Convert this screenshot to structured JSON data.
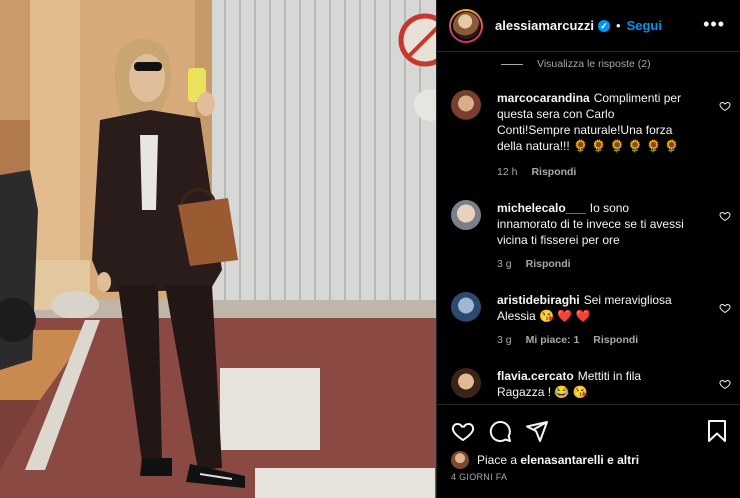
{
  "post": {
    "username": "alessiamarcuzzi",
    "verified_mark": "✓",
    "separator": "•",
    "follow_label": "Segui",
    "more_label": "•••"
  },
  "view_replies": "Visualizza le risposte (2)",
  "comments": [
    {
      "user": "marcocarandina",
      "text": "Complimenti per questa sera con Carlo Conti!Sempre naturale!Una forza della natura!!! 🌻 🌻 🌻 🌻 🌻 🌻",
      "time": "12 h",
      "likes": "",
      "reply": "Rispondi"
    },
    {
      "user": "michelecalo___",
      "text": "Io sono innamorato di te invece se ti avessi vicina ti fisserei per ore",
      "time": "3 g",
      "likes": "",
      "reply": "Rispondi"
    },
    {
      "user": "aristidebiraghi",
      "text": "Sei meravigliosa Alessia 😘 ❤️ ❤️",
      "time": "3 g",
      "likes": "Mi piace: 1",
      "reply": "Rispondi"
    },
    {
      "user": "flavia.cercato",
      "text": "Mettiti in fila Ragazza ! 😂 😘",
      "time": "",
      "likes": "",
      "reply": ""
    }
  ],
  "likes_prefix": "Piace a ",
  "likes_user": "elenasantarelli",
  "likes_suffix": " e altri",
  "posted_ago": "4 GIORNI FA",
  "icons": [
    "heart-icon",
    "comment-icon",
    "share-icon",
    "bookmark-icon",
    "more-icon",
    "verified-icon"
  ],
  "colors": {
    "accent": "#0095f6",
    "muted": "#a8a8a8",
    "background": "#000000"
  }
}
